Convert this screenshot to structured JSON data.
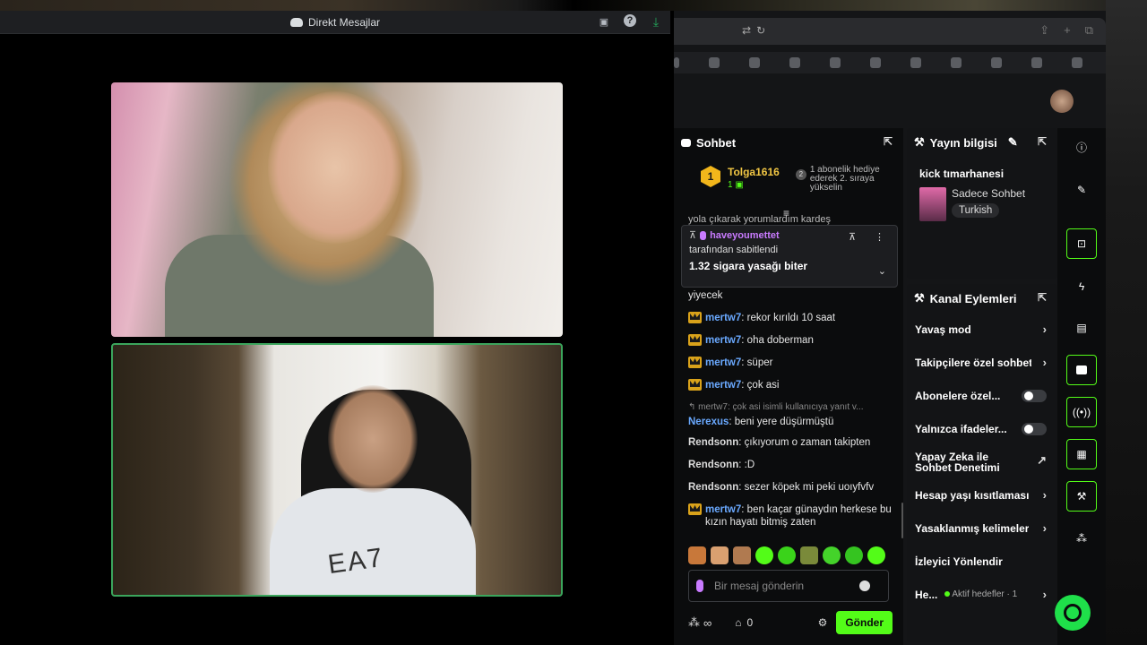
{
  "discord": {
    "title": "Direkt Mesajlar",
    "icons": [
      "screenshare-icon",
      "help-icon",
      "download-icon"
    ]
  },
  "video": {
    "tile1_logo_text": "",
    "tile2_shirt_text": "EA7"
  },
  "chat": {
    "header": "Sohbet",
    "leaderboard": {
      "rank": "1",
      "user": "Tolga1616",
      "sub_count": "1",
      "gift_badge": "2",
      "gift_text": "1 abonelik hediye ederek 2. sıraya yükselin"
    },
    "scrolled_text": "yola çıkarak yorumlardım kardeş",
    "pinned": {
      "user": "haveyoumettet",
      "by_text": "tarafından sabitlendi",
      "message": "1.32 sigara yasağı biter"
    },
    "messages": [
      {
        "text": "yiyecek"
      },
      {
        "user": "mertw7",
        "text": ": rekor kırıldı 10 saat",
        "crown": true
      },
      {
        "user": "mertw7",
        "text": ": oha doberman",
        "crown": true
      },
      {
        "user": "mertw7",
        "text": ": süper",
        "crown": true
      },
      {
        "user": "mertw7",
        "text": ": çok asi",
        "crown": true
      },
      {
        "reply": "mertw7: çok asi isimli kullanıcıya yanıt v...",
        "user": "Nerexus",
        "text": ": beni yere düşürmüştü"
      },
      {
        "user": "Rendsonn",
        "text": ": çıkıyorum o zaman takipten"
      },
      {
        "user": "Rendsonn",
        "text": ": :D"
      },
      {
        "user": "Rendsonn",
        "text": ": sezer köpek mi peki uoıyfvfv"
      },
      {
        "user": "mertw7",
        "text": ": ben kaçar günaydın herkese bu kızın hayatı bitmiş zaten",
        "crown": true
      }
    ],
    "input_placeholder": "Bir mesaj gönderin",
    "infinity": "∞",
    "points": "0",
    "send_label": "Gönder"
  },
  "stream_info": {
    "header": "Yayın bilgisi",
    "channel": "kick tımarhanesi",
    "category": "Sadece Sohbet",
    "language": "Turkish"
  },
  "channel_actions": {
    "header": "Kanal Eylemleri",
    "items": [
      {
        "label": "Yavaş mod",
        "type": "arrow"
      },
      {
        "label": "Takipçilere özel sohbet",
        "type": "arrow"
      },
      {
        "label": "Abonelere özel...",
        "type": "toggle"
      },
      {
        "label": "Yalnızca ifadeler...",
        "type": "toggle"
      },
      {
        "label": "Yapay Zeka ile Sohbet Denetimi",
        "type": "external"
      },
      {
        "label": "Hesap yaşı kısıtlaması",
        "type": "arrow"
      },
      {
        "label": "Yasaklanmış kelimeler",
        "type": "arrow"
      },
      {
        "label": "İzleyici Yönlendir",
        "type": "none"
      },
      {
        "label": "He...",
        "sub": "Aktif hedefler · 1",
        "type": "arrow"
      }
    ]
  },
  "colors": {
    "accent": "#53fc18",
    "username_blue": "#6aa9ff",
    "pinned_user": "#c97bff",
    "leader_gold": "#f2c744"
  }
}
